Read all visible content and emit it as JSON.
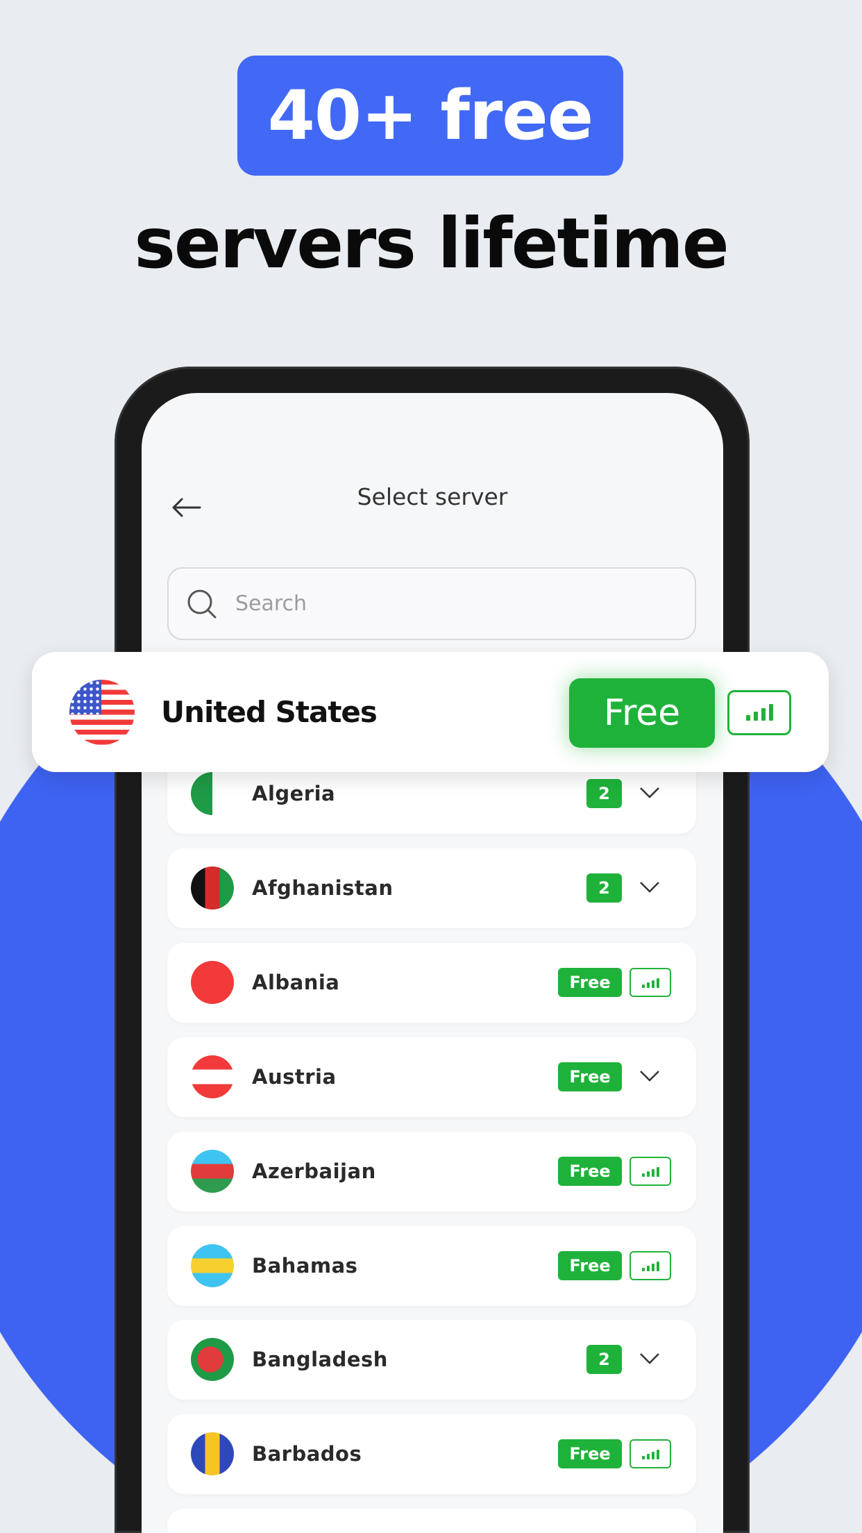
{
  "promo": {
    "badge": "40+ free",
    "headline": "servers lifetime"
  },
  "header": {
    "title": "Select server",
    "back_icon": "arrow-left-icon"
  },
  "search": {
    "placeholder": "Search",
    "value": ""
  },
  "featured": {
    "country": "United States",
    "label": "Free",
    "signal_icon": "signal-bars-icon"
  },
  "colors": {
    "accent_blue": "#3e63f2",
    "free_green": "#1fb23a"
  },
  "servers": [
    {
      "country": "Algeria",
      "badge": "2",
      "action": "chevron-down"
    },
    {
      "country": "Afghanistan",
      "badge": "2",
      "action": "chevron-down"
    },
    {
      "country": "Albania",
      "badge": "Free",
      "action": "signal"
    },
    {
      "country": "Austria",
      "badge": "Free",
      "action": "chevron-down"
    },
    {
      "country": "Azerbaijan",
      "badge": "Free",
      "action": "signal"
    },
    {
      "country": "Bahamas",
      "badge": "Free",
      "action": "signal"
    },
    {
      "country": "Bangladesh",
      "badge": "2",
      "action": "chevron-down"
    },
    {
      "country": "Barbados",
      "badge": "Free",
      "action": "signal"
    }
  ]
}
